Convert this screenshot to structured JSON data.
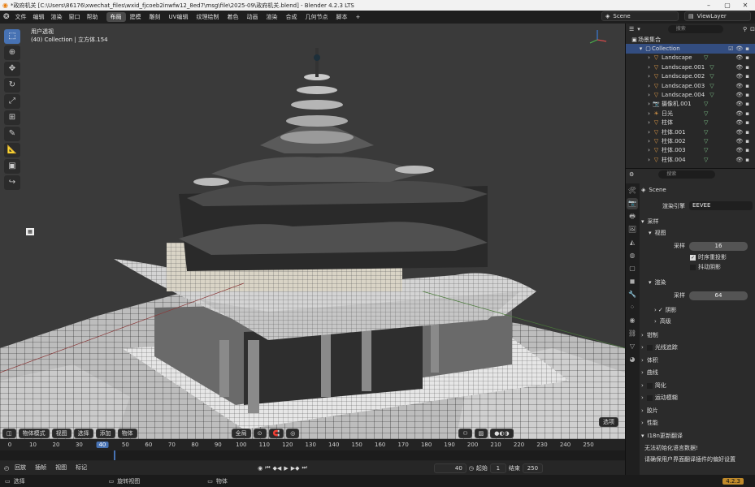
{
  "window": {
    "title": "*政府机关 [C:\\Users\\86176\\xwechat_files\\wxid_fjcoeb2inwfw12_8ed7\\msg\\file\\2025-09\\政府机关.blend] - Blender 4.2.3 LTS"
  },
  "menu": [
    "文件",
    "编辑",
    "渲染",
    "窗口",
    "帮助"
  ],
  "workspaces": [
    "布局",
    "建模",
    "雕刻",
    "UV编辑",
    "纹理绘制",
    "着色",
    "动画",
    "渲染",
    "合成",
    "几何节点",
    "脚本"
  ],
  "active_workspace": "布局",
  "scene_name": "Scene",
  "view_layer": "ViewLayer",
  "viewport": {
    "view_name": "用户透视",
    "collection_info": "(40) Collection | 立方体.154",
    "mode": "物体模式",
    "menus": [
      "视图",
      "选择",
      "添加",
      "物体"
    ],
    "transform_orientation": "全局",
    "select_button": "选项"
  },
  "timeline": {
    "frames": [
      "0",
      "10",
      "20",
      "30",
      "40",
      "50",
      "60",
      "70",
      "80",
      "90",
      "100",
      "110",
      "120",
      "130",
      "140",
      "150",
      "160",
      "170",
      "180",
      "190",
      "200",
      "210",
      "220",
      "230",
      "240",
      "250"
    ],
    "current_frame": "40",
    "playback_menus": [
      "回放",
      "插帧",
      "视图",
      "标记"
    ],
    "frame_field": "40",
    "start_label": "起始",
    "start_value": "1",
    "end_label": "结束",
    "end_value": "250"
  },
  "outliner": {
    "search_placeholder": "搜索",
    "root": "场景集合",
    "collection": "Collection",
    "items": [
      {
        "name": "Landscape",
        "icon": "mesh-icon"
      },
      {
        "name": "Landscape.001",
        "icon": "mesh-icon"
      },
      {
        "name": "Landscape.002",
        "icon": "mesh-icon"
      },
      {
        "name": "Landscape.003",
        "icon": "mesh-icon"
      },
      {
        "name": "Landscape.004",
        "icon": "mesh-icon"
      },
      {
        "name": "摄像机.001",
        "icon": "camera-icon"
      },
      {
        "name": "日光",
        "icon": "sun-icon"
      },
      {
        "name": "柱体",
        "icon": "mesh-icon"
      },
      {
        "name": "柱体.001",
        "icon": "mesh-icon"
      },
      {
        "name": "柱体.002",
        "icon": "mesh-icon"
      },
      {
        "name": "柱体.003",
        "icon": "mesh-icon"
      },
      {
        "name": "柱体.004",
        "icon": "mesh-icon"
      }
    ]
  },
  "properties": {
    "search_placeholder": "搜索",
    "scene": "Scene",
    "render_engine_label": "渲染引擎",
    "render_engine": "EEVEE",
    "sampling": "采样",
    "viewport": "视图",
    "samples_label": "采样",
    "viewport_samples": "16",
    "temporal_reprojection": "时序重投影",
    "jitter_shadows": "抖动阴影",
    "render": "渲染",
    "render_samples_label": "采样",
    "render_samples": "64",
    "shadows": "阴影",
    "advanced": "高级",
    "clamping": "钳制",
    "raytracing": "光线追踪",
    "volumes": "体积",
    "curves": "曲线",
    "simplify": "简化",
    "motion_blur": "运动模糊",
    "film": "胶片",
    "performance": "性能",
    "i18n_panel": "I18n更新翻译",
    "i18n_warning": "无法初始化语言数据!",
    "i18n_hint": "请确保用户界面翻译插件的偏好设置"
  },
  "status": {
    "select": "选择",
    "rotate_view": "旋转视图",
    "object": "物体",
    "version": "4.2.3"
  },
  "colors": {
    "accent": "#4772b3",
    "viewport_bg": "#3a3a3a",
    "panel_bg": "#2b2b2b"
  }
}
